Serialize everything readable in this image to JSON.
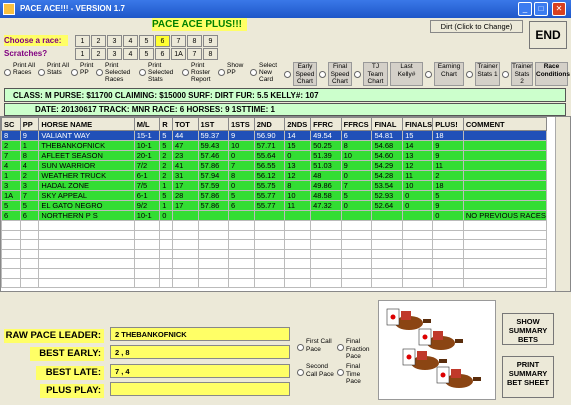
{
  "window": {
    "title": "PACE ACE!!! - VERSION 1.7"
  },
  "header": {
    "app_title": "PACE ACE PLUS!!!",
    "dirt_button": "Dirt (Click to Change)",
    "end_button": "END"
  },
  "race_row": {
    "label": "Choose  a race:",
    "buttons": [
      "1",
      "2",
      "3",
      "4",
      "5",
      "6",
      "7",
      "8",
      "9"
    ]
  },
  "scratch_row": {
    "label": "Scratches?",
    "buttons": [
      "1",
      "2",
      "3",
      "4",
      "5",
      "6",
      "1A",
      "7",
      "8"
    ]
  },
  "options": [
    "Print All Races",
    "Print All Stats",
    "Print PP",
    "Print Selected Races",
    "Print Selected Stats",
    "Print Roster Report",
    "Show PP",
    "Select New Card"
  ],
  "chart_buttons": [
    "Early Speed Chart",
    "Final Speed Chart",
    "TJ Team Chart",
    "Last Kelly#",
    "Earning Chart",
    "Trainer Stats 1",
    "Trainer Stats 2",
    "Race Conditions"
  ],
  "info": {
    "line1": "CLASS:  M     PURSE:  $11700     CLAIMING:  $15000      SURF:  DIRT      FUR:  5.5    KELLY#:  107",
    "line2": "DATE:  20130617                   TRACK:  MNR                   RACE:  6                  HORSES:  9              1STTIME:  1"
  },
  "table": {
    "headers": [
      "SC",
      "PP",
      "HORSE NAME",
      "M/L",
      "R",
      "TOT",
      "1ST",
      "1STS",
      "2ND",
      "2NDS",
      "FFRC",
      "FFRCS",
      "FINAL",
      "FINALS",
      "PLUS!",
      "COMMENT"
    ],
    "rows": [
      [
        "8",
        "9",
        "VALIANT WAY",
        "15-1",
        "5",
        "44",
        "59.37",
        "9",
        "56.90",
        "14",
        "49.54",
        "6",
        "54.81",
        "15",
        "18",
        ""
      ],
      [
        "2",
        "1",
        "THEBANKOFNICK",
        "10-1",
        "5",
        "47",
        "59.43",
        "10",
        "57.71",
        "15",
        "50.25",
        "8",
        "54.68",
        "14",
        "9",
        ""
      ],
      [
        "7",
        "8",
        "AFLEET SEASON",
        "20-1",
        "2",
        "23",
        "57.46",
        "0",
        "55.64",
        "0",
        "51.39",
        "10",
        "54.60",
        "13",
        "9",
        ""
      ],
      [
        "4",
        "4",
        "SUN WARRIOR",
        "7/2",
        "2",
        "41",
        "57.86",
        "7",
        "56.55",
        "13",
        "51.03",
        "9",
        "54.29",
        "12",
        "11",
        ""
      ],
      [
        "1",
        "2",
        "WEATHER TRUCK",
        "6-1",
        "2",
        "31",
        "57.94",
        "8",
        "56.12",
        "12",
        "48",
        "0",
        "54.28",
        "11",
        "2",
        ""
      ],
      [
        "3",
        "3",
        "HADAL ZONE",
        "7/5",
        "1",
        "17",
        "57.59",
        "0",
        "55.75",
        "8",
        "49.86",
        "7",
        "53.54",
        "10",
        "18",
        ""
      ],
      [
        "1A",
        "7",
        "SKY APPEAL",
        "6-1",
        "5",
        "28",
        "57.86",
        "5",
        "55.77",
        "10",
        "48.58",
        "5",
        "52.93",
        "0",
        "5",
        ""
      ],
      [
        "5",
        "5",
        "EL GATO NEGRO",
        "9/2",
        "1",
        "17",
        "57.86",
        "6",
        "55.77",
        "11",
        "47.32",
        "0",
        "52.64",
        "0",
        "9",
        ""
      ],
      [
        "6",
        "6",
        "NORTHERN P S",
        "10-1",
        "0",
        "",
        "",
        "",
        "",
        "",
        "",
        "",
        "",
        "",
        "0",
        "NO PREVIOUS RACES"
      ]
    ]
  },
  "summary": {
    "raw_label": "RAW PACE LEADER:",
    "raw_value": "2     THEBANKOFNICK",
    "early_label": "BEST EARLY:",
    "early_value": "2    ,    8",
    "late_label": "BEST LATE:",
    "late_value": "7    ,    4",
    "plus_label": "PLUS PLAY:",
    "plus_value": ""
  },
  "pace_options": [
    "First Call Pace",
    "Second Call Pace",
    "Final Fraction Pace",
    "Final Time Pace"
  ],
  "action_buttons": {
    "show": "SHOW SUMMARY BETS",
    "print": "PRINT SUMMARY BET SHEET"
  },
  "colors": {
    "titlebar": "#1e56c8",
    "selected_row": "#2050b8",
    "data_row": "#33dd33",
    "highlight": "#ffff66"
  }
}
